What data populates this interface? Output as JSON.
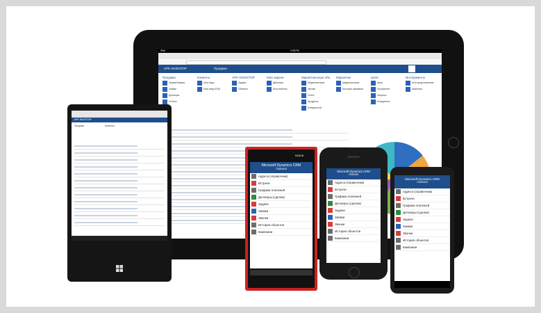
{
  "ipad": {
    "status": {
      "carrier": "iPad",
      "time": "3:38 PM"
    },
    "app_title": "APK INVESTOP",
    "nav_tab": "Продажи",
    "sections": [
      {
        "title": "Продажи",
        "items": [
          "Заявки/Заказы",
          "Заявки",
          "Договоры",
          "Отчеты"
        ]
      },
      {
        "title": "Клиенты",
        "items": [
          "Мои лица",
          "Мои лица (ЮЛ)"
        ]
      },
      {
        "title": "APK INVESTOP",
        "items": [
          "Задачи",
          "Объекты"
        ]
      },
      {
        "title": "Мои задачи",
        "items": [
          "Действия",
          "Мои клиенты"
        ]
      },
      {
        "title": "Маркетинговые объ.",
        "items": [
          "Маркетинговые",
          "Звонки",
          "Счета",
          "Продукты",
          "Конкурентов"
        ]
      },
      {
        "title": "Маркетинг",
        "items": [
          "Маркетинговые",
          "Быстрые кампании"
        ]
      },
      {
        "title": "Цели",
        "items": [
          "Цели",
          "Показатели",
          "Запросы",
          "Конкуренты"
        ]
      },
      {
        "title": "Инструменты",
        "items": [
          "Мои представления",
          "Шаблоны"
        ]
      }
    ],
    "table_rows": 14,
    "pie_colors": [
      "#2f6ec0",
      "#f0a640",
      "#e34d3b",
      "#7fb34a",
      "#9b59b6",
      "#f4d03f",
      "#3fb7c6"
    ]
  },
  "surface": {
    "app_title": "APK INVESTOP",
    "sections": [
      "Продажи",
      "Клиенты"
    ]
  },
  "crm_app": {
    "title": "Microsoft Dynamics CRM",
    "subtitle": "ГЛАВНАЯ",
    "brand": "NOKIA",
    "menu": [
      {
        "label": "Адреса (справочник)",
        "color": "#6d6d6d"
      },
      {
        "label": "Встречи",
        "color": "#d63c3c"
      },
      {
        "label": "Графики платежей",
        "color": "#6d6d6d"
      },
      {
        "label": "Договоры (сделки)",
        "color": "#2e8b3a"
      },
      {
        "label": "Задачи",
        "color": "#d63c3c"
      },
      {
        "label": "Заявки",
        "color": "#2a62b8"
      },
      {
        "label": "Звонки",
        "color": "#d63c3c"
      },
      {
        "label": "История объектов",
        "color": "#6d6d6d"
      },
      {
        "label": "Кампании",
        "color": "#6d6d6d"
      }
    ]
  }
}
